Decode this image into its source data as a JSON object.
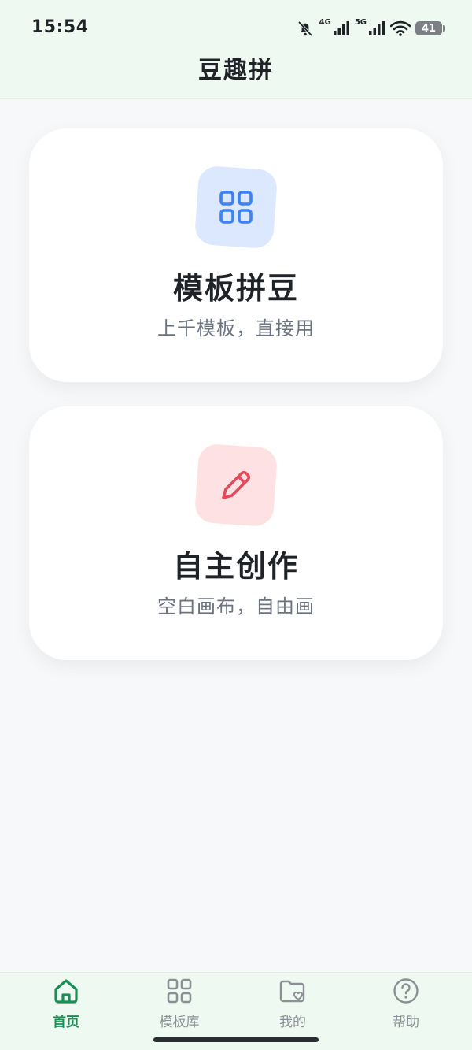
{
  "status_bar": {
    "time": "15:54",
    "network_1": "4G",
    "network_2": "5G",
    "battery": "41",
    "icons": [
      "bell-muted-icon",
      "signal-4g-icon",
      "signal-5g-icon",
      "wifi-icon",
      "battery-icon"
    ]
  },
  "header": {
    "title": "豆趣拼"
  },
  "cards": [
    {
      "title": "模板拼豆",
      "subtitle": "上千模板，直接用",
      "icon": "grid-icon",
      "icon_color": "#3b82f6",
      "bg_color": "#dbe8fd"
    },
    {
      "title": "自主创作",
      "subtitle": "空白画布，自由画",
      "icon": "pencil-icon",
      "icon_color": "#e8485a",
      "bg_color": "#fde1e3"
    }
  ],
  "bottom_nav": {
    "active": "home",
    "items": [
      {
        "key": "home",
        "label": "首页",
        "icon": "home-icon"
      },
      {
        "key": "templates",
        "label": "模板库",
        "icon": "grid-icon"
      },
      {
        "key": "mine",
        "label": "我的",
        "icon": "folder-heart-icon"
      },
      {
        "key": "help",
        "label": "帮助",
        "icon": "help-circle-icon"
      }
    ]
  },
  "colors": {
    "accent": "#1a8f55",
    "header_bg": "#eefaf1",
    "page_bg": "#f7f8fa",
    "inactive": "#8b9096"
  }
}
